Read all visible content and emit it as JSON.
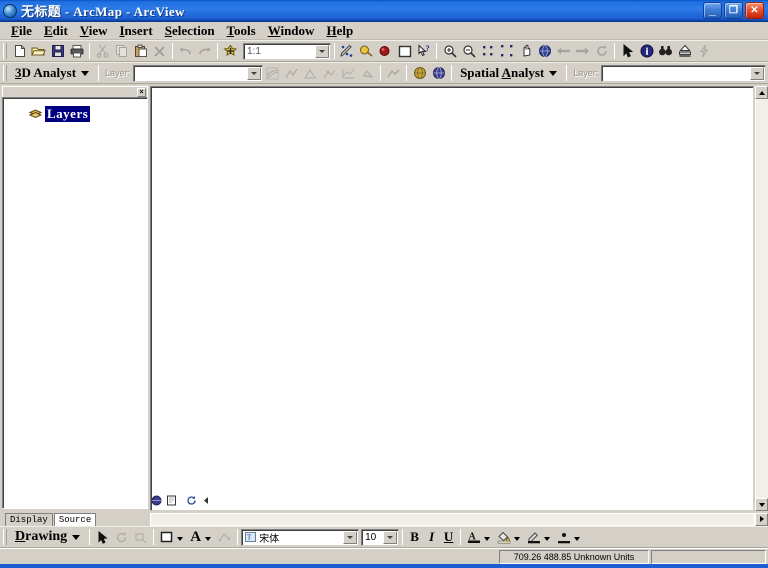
{
  "window": {
    "title": "无标题 - ArcMap - ArcView",
    "app_icon": "globe-icon",
    "buttons": {
      "minimize": "minimize-icon",
      "restore": "restore-icon",
      "close": "close-icon"
    },
    "minimize_glyph": "_",
    "restore_glyph": "❐",
    "close_glyph": "✕"
  },
  "menubar": {
    "items": [
      {
        "name": "file",
        "accel": "F",
        "rest": "ile"
      },
      {
        "name": "edit",
        "accel": "E",
        "rest": "dit"
      },
      {
        "name": "view",
        "accel": "V",
        "rest": "iew"
      },
      {
        "name": "insert",
        "accel": "I",
        "rest": "nsert"
      },
      {
        "name": "selection",
        "accel": "S",
        "rest": "election"
      },
      {
        "name": "tools",
        "accel": "T",
        "rest": "ools"
      },
      {
        "name": "window",
        "accel": "W",
        "rest": "indow"
      },
      {
        "name": "help",
        "accel": "H",
        "rest": "elp"
      }
    ]
  },
  "standard_toolbar": {
    "icons": [
      "new-map-icon",
      "open-icon",
      "save-icon",
      "print-icon",
      "cut-icon",
      "copy-icon",
      "paste-icon",
      "delete-icon",
      "undo-icon",
      "redo-icon",
      "add-data-icon"
    ],
    "scale_combo": {
      "name": "map-scale-combo",
      "value": "1:1",
      "placeholder": "1:1"
    },
    "right_icons": [
      "editor-toolbar-icon",
      "map-tips-icon",
      "show-hide-toc-icon",
      "layout-view-icon",
      "whats-this-icon",
      "zoom-in-icon",
      "zoom-out-icon",
      "fixed-zoom-in-icon",
      "fixed-zoom-out-icon",
      "pan-icon",
      "full-extent-icon",
      "go-back-extent-icon",
      "go-forward-extent-icon",
      "refresh-icon",
      "select-features-icon",
      "identify-icon",
      "find-icon",
      "measure-icon",
      "hyperlink-icon"
    ]
  },
  "analyst_toolbar": {
    "threed": {
      "name": "3d-analyst-menu",
      "accel": "3",
      "rest": "D Analyst",
      "layer_label": "Layer:",
      "layer_combo": {
        "name": "3d-analyst-layer-combo",
        "value": "",
        "placeholder": ""
      },
      "tool_icons": [
        "contour-icon",
        "steepest-path-icon",
        "line-of-sight-icon",
        "interpolate-line-icon",
        "profile-graph-icon",
        "surface-area-icon",
        "create-profile-icon",
        "scene-icon"
      ]
    },
    "enabled_icons": [
      "globe-scene-icon",
      "globe-view-icon"
    ],
    "spatial": {
      "name": "spatial-analyst-menu",
      "label_pre": "Spatial ",
      "accel": "A",
      "rest": "nalyst",
      "layer_label": "Layer:",
      "layer_combo": {
        "name": "spatial-analyst-layer-combo",
        "value": "",
        "placeholder": ""
      }
    }
  },
  "toc": {
    "close_glyph": "×",
    "root_node": {
      "name": "layers-root-node",
      "label": "Layers",
      "icon": "layers-stack-icon",
      "selected": true
    },
    "tabs": [
      {
        "name": "tab-display",
        "label": "Display",
        "active": false
      },
      {
        "name": "tab-source",
        "label": "Source",
        "active": true
      }
    ]
  },
  "map_frame": {
    "mini_tools": [
      "data-view-icon",
      "layout-view-icon",
      "refresh-view-icon",
      "pause-drawing-icon"
    ],
    "scroll": {
      "up": "scroll-up-arrow",
      "down": "scroll-down-arrow",
      "left": "scroll-left-arrow",
      "right": "scroll-right-arrow"
    }
  },
  "drawing_toolbar": {
    "menu": {
      "name": "drawing-menu",
      "accel": "D",
      "rest": "rawing"
    },
    "tool_icons": [
      "select-elements-icon",
      "rotate-element-icon",
      "nudge-element-icon"
    ],
    "shape_button": {
      "name": "new-rectangle-tool",
      "icon": "rectangle-icon"
    },
    "text_button": {
      "name": "new-text-tool",
      "glyph": "A"
    },
    "node_button": {
      "name": "edit-vertices-icon"
    },
    "font_combo": {
      "name": "font-family-combo",
      "value": "宋体",
      "placeholder": "宋体",
      "icon": "font-icon"
    },
    "size_combo": {
      "name": "font-size-combo",
      "value": "10",
      "placeholder": "10"
    },
    "bold": {
      "name": "bold-button",
      "glyph": "B"
    },
    "italic": {
      "name": "italic-button",
      "glyph": "I"
    },
    "underline": {
      "name": "underline-button",
      "glyph": "U"
    },
    "colors": [
      {
        "name": "font-color-picker",
        "glyph": "A",
        "swatch": "#000000"
      },
      {
        "name": "fill-color-picker",
        "icon": "paint-bucket-icon",
        "swatch": "#d8d0b0"
      },
      {
        "name": "line-color-picker",
        "icon": "pencil-line-icon",
        "swatch": "#000000"
      },
      {
        "name": "marker-color-picker",
        "icon": "marker-dot-icon",
        "swatch": "#000000"
      }
    ]
  },
  "statusbar": {
    "coordinates": "709.26  488.85 Unknown Units"
  },
  "colors": {
    "title_blue": "#2e7ce8",
    "chrome_gray": "#d4d0c8",
    "selection_blue": "#000080",
    "map_white": "#ffffff"
  }
}
